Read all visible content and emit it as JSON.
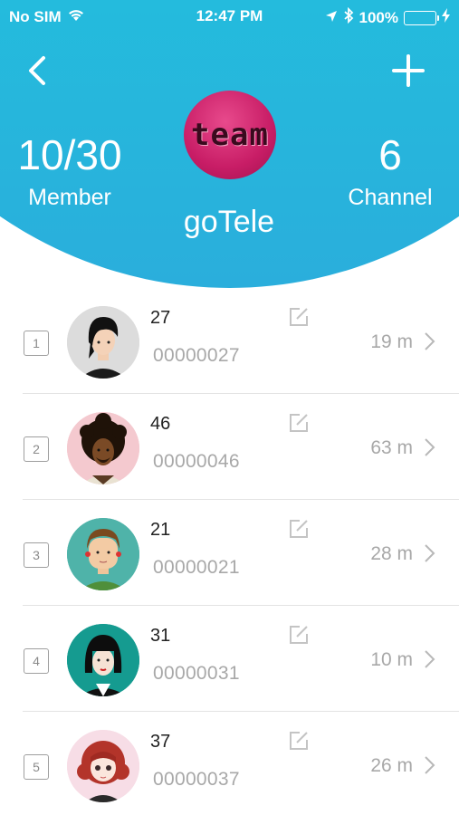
{
  "status_bar": {
    "carrier": "No SIM",
    "time": "12:47 PM",
    "battery": "100%"
  },
  "header": {
    "team_logo_text": "team",
    "members": {
      "value": "10/30",
      "label": "Member"
    },
    "channels": {
      "value": "6",
      "label": "Channel"
    },
    "team_name": "goTele"
  },
  "members": [
    {
      "index": "1",
      "name": "27",
      "phone": "00000027",
      "time": "19 m",
      "avatar": "avatar-black-hair-man",
      "avatar_bg": "#dcdcdc"
    },
    {
      "index": "2",
      "name": "46",
      "phone": "00000046",
      "time": "63 m",
      "avatar": "avatar-afro-man",
      "avatar_bg": "#f4c9cf"
    },
    {
      "index": "3",
      "name": "21",
      "phone": "00000021",
      "time": "28 m",
      "avatar": "avatar-brown-hair-man",
      "avatar_bg": "#4fb3a9"
    },
    {
      "index": "4",
      "name": "31",
      "phone": "00000031",
      "time": "10 m",
      "avatar": "avatar-bob-hair-woman",
      "avatar_bg": "#159b90"
    },
    {
      "index": "5",
      "name": "37",
      "phone": "00000037",
      "time": "26 m",
      "avatar": "avatar-red-hair-girl",
      "avatar_bg": "#f7dde6"
    }
  ],
  "colors": {
    "header_gradient_top": "#20cfe0",
    "header_gradient_bottom": "#2aaedc",
    "battery_green": "#7dfa5a",
    "team_logo": "#c81d66"
  }
}
